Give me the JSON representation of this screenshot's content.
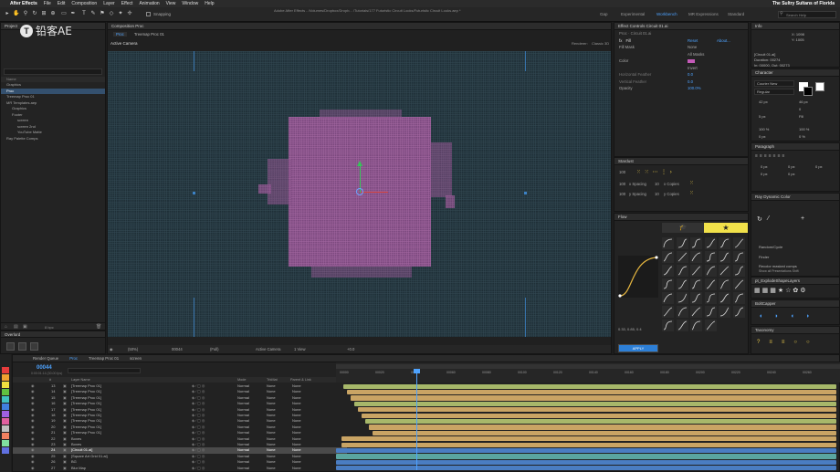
{
  "menubar": {
    "app": "After Effects",
    "items": [
      "File",
      "Edit",
      "Composition",
      "Layer",
      "Effect",
      "Animation",
      "View",
      "Window",
      "Help"
    ],
    "right": "The Sultry Sultans of Florida"
  },
  "window_title": "Adobe After Effects - /Volumes/Dropbox/Dropb... /Tutorials/177 Futuristic Circuit Looks/Futuristic Circuit Looks.aep *",
  "toolbar": {
    "snapping": "Snapping",
    "workspaces": [
      "Gap",
      "Experimental",
      "Workbench",
      "MR Expressions",
      "Standard"
    ],
    "active_workspace": "Workbench",
    "search_placeholder": "Search Help"
  },
  "watermark": "铅客AE",
  "project": {
    "title": "Project",
    "items": [
      "Graphics",
      "Proc",
      "Treemap Proc 01",
      "MR Templates.aep",
      "Graphics",
      "Footer",
      "screen",
      "screen 2nd",
      "YouTube Matte",
      "Ray Palette Comps"
    ],
    "selected": 1,
    "search_placeholder": "",
    "bit_depth": "8 bpc"
  },
  "composition": {
    "panel_title": "Composition Proc",
    "tabs": [
      "Proc",
      "Treemap Proc 01"
    ],
    "active_camera": "Active Camera",
    "renderer_label": "Renderer:",
    "renderer": "Classic 3D",
    "footer": {
      "zoom": "(50%)",
      "timecode": "00044",
      "resolution": "(Full)",
      "camera": "Active Camera",
      "views": "1 View",
      "exposure": "+0.0"
    }
  },
  "effect_controls": {
    "title": "Effect Controls Circuit 01.ai",
    "subtitle": "Proc · Circuit 01.ai",
    "effect_name": "Fill",
    "reset": "Reset",
    "about": "About...",
    "rows": [
      {
        "label": "Fill Mask",
        "value": "None"
      },
      {
        "label": "",
        "value": "All Masks"
      },
      {
        "label": "Color",
        "value": ""
      },
      {
        "label": "",
        "value": "Invert"
      },
      {
        "label": "Horizontal Feather",
        "value": "0.0"
      },
      {
        "label": "Vertical Feather",
        "value": "0.0"
      },
      {
        "label": "Opacity",
        "value": "100.0%"
      }
    ],
    "fill_color": "#c45ab8"
  },
  "stardust": {
    "title": "Stardust",
    "rows": [
      {
        "a": "100",
        "b": ""
      },
      {
        "a": "100",
        "b": "x Spacing",
        "c": "10",
        "d": "x Copies"
      },
      {
        "a": "100",
        "b": "y Spacing",
        "c": "10",
        "d": "y Copies"
      }
    ]
  },
  "flow": {
    "title": "Flow",
    "values": "0.33, 0.85, 0.4",
    "apply": "APPLY"
  },
  "info": {
    "title": "Info",
    "x": "X: 1098",
    "y": "Y: 1005",
    "layer": "[Circuit 01.ai]",
    "duration": "Duration: 00274",
    "in_out": "In: 00000, Out: 00273"
  },
  "character": {
    "title": "Character",
    "font": "Courier New",
    "style": "Regular",
    "size": "42 px",
    "leading": "46 px",
    "tracking": "0",
    "stroke": "5 px",
    "fill_stroke": "Fill",
    "percents": [
      "100 %",
      "100 %"
    ],
    "baseline": "0 px",
    "tsume": "0 %"
  },
  "paragraph": {
    "title": "Paragraph",
    "values": [
      "0 px",
      "0 px",
      "0 px",
      "0 px",
      "0 px"
    ]
  },
  "ray_dynamic_color": {
    "title": "Ray Dynamic Color",
    "random_label": "Random/Cycle",
    "finder": "Finder",
    "recolor": "Recolor masked comps",
    "checkbox": "Show all Presentations Shift"
  },
  "explode": {
    "title": "pt_ExplodeShapeLayers"
  },
  "boltcapper": {
    "title": "BoltCapper"
  },
  "taxonomy": {
    "title": "Taxonomy"
  },
  "timeline": {
    "tabs": [
      "Render Queue",
      "Proc",
      "Treemap Proc 01",
      "screen"
    ],
    "active_tab": "Proc",
    "timecode": "00044",
    "timecode_sub": "0:00:01:14 (30.00 fps)",
    "columns": [
      "#",
      "Layer Name",
      "Mode",
      "TrkMat",
      "Parent & Link"
    ],
    "layers": [
      {
        "num": "13",
        "name": "[Treemap Proc 01]",
        "mode": "Normal",
        "trk": "None",
        "parent": "None"
      },
      {
        "num": "14",
        "name": "[Treemap Proc 01]",
        "mode": "Normal",
        "trk": "None",
        "parent": "None"
      },
      {
        "num": "15",
        "name": "[Treemap Proc 01]",
        "mode": "Normal",
        "trk": "None",
        "parent": "None"
      },
      {
        "num": "16",
        "name": "[Treemap Proc 01]",
        "mode": "Normal",
        "trk": "None",
        "parent": "None"
      },
      {
        "num": "17",
        "name": "[Treemap Proc 01]",
        "mode": "Normal",
        "trk": "None",
        "parent": "None"
      },
      {
        "num": "18",
        "name": "[Treemap Proc 01]",
        "mode": "Normal",
        "trk": "None",
        "parent": "None"
      },
      {
        "num": "19",
        "name": "[Treemap Proc 01]",
        "mode": "Normal",
        "trk": "None",
        "parent": "None"
      },
      {
        "num": "20",
        "name": "[Treemap Proc 01]",
        "mode": "Normal",
        "trk": "None",
        "parent": "None"
      },
      {
        "num": "21",
        "name": "[Treemap Proc 01]",
        "mode": "Normal",
        "trk": "None",
        "parent": "None"
      },
      {
        "num": "22",
        "name": "Boxes",
        "mode": "Normal",
        "trk": "None",
        "parent": "None"
      },
      {
        "num": "23",
        "name": "Boxes",
        "mode": "Normal",
        "trk": "None",
        "parent": "None"
      },
      {
        "num": "24",
        "name": "[Circuit 01.ai]",
        "mode": "Normal",
        "trk": "None",
        "parent": "None"
      },
      {
        "num": "25",
        "name": "[Square Art Grid 01.ai]",
        "mode": "Normal",
        "trk": "None",
        "parent": "None"
      },
      {
        "num": "26",
        "name": "BG",
        "mode": "Normal",
        "trk": "None",
        "parent": "None"
      },
      {
        "num": "27",
        "name": "Blur Map",
        "mode": "Normal",
        "trk": "None",
        "parent": "None"
      }
    ],
    "selected_layer": 11,
    "ruler": [
      "00000",
      "00020",
      "00040",
      "00060",
      "00080",
      "00100",
      "00120",
      "00140",
      "00160",
      "00180",
      "00200",
      "00220",
      "00240",
      "00260"
    ],
    "bar_colors": {
      "tan": "#c9a464",
      "green": "#a7b86a",
      "blue": "#4a7dc2",
      "teal": "#5aa5a0"
    },
    "label_colors": [
      "#e63c3c",
      "#f0a030",
      "#f0e040",
      "#60c040",
      "#40c0c0",
      "#4080e0",
      "#a060e0",
      "#e060a0",
      "#c0c0c0",
      "#f08060",
      "#80e0a0",
      "#6070e0"
    ]
  }
}
